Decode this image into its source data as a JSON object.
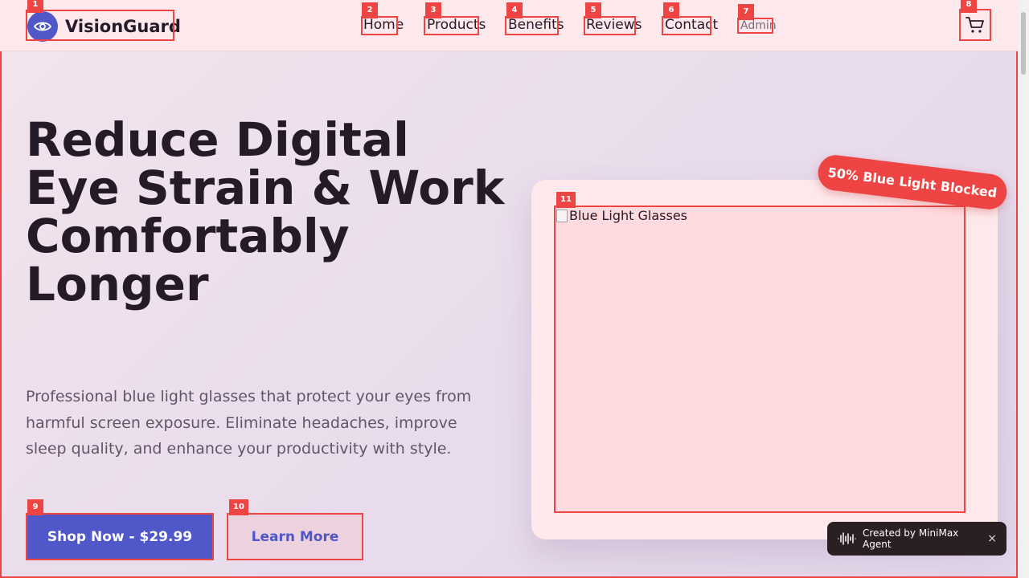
{
  "brand": {
    "name": "VisionGuard",
    "logo_icon": "eye-icon",
    "accent": "#5057c9"
  },
  "nav": {
    "items": [
      {
        "label": "Home",
        "marker": "2"
      },
      {
        "label": "Products",
        "marker": "3"
      },
      {
        "label": "Benefits",
        "marker": "4"
      },
      {
        "label": "Reviews",
        "marker": "5"
      },
      {
        "label": "Contact",
        "marker": "6"
      },
      {
        "label": "Admin",
        "marker": "7"
      }
    ],
    "cart_icon": "cart-icon"
  },
  "hero": {
    "title": "Reduce Digital Eye Strain & Work Comfortably Longer",
    "description": "Professional blue light glasses that protect your eyes from harmful screen exposure. Eliminate headaches, improve sleep quality, and enhance your productivity with style.",
    "primary_button": "Shop Now - $29.99",
    "secondary_button": "Learn More"
  },
  "product": {
    "image_alt": "Blue Light Glasses",
    "badge": "50% Blue Light Blocked",
    "badge_color": "#ef4444"
  },
  "toast": {
    "label": "Created by MiniMax Agent",
    "close": "×"
  },
  "markers": {
    "logo": "1",
    "cart": "8",
    "primary": "9",
    "secondary": "10",
    "image": "11"
  }
}
